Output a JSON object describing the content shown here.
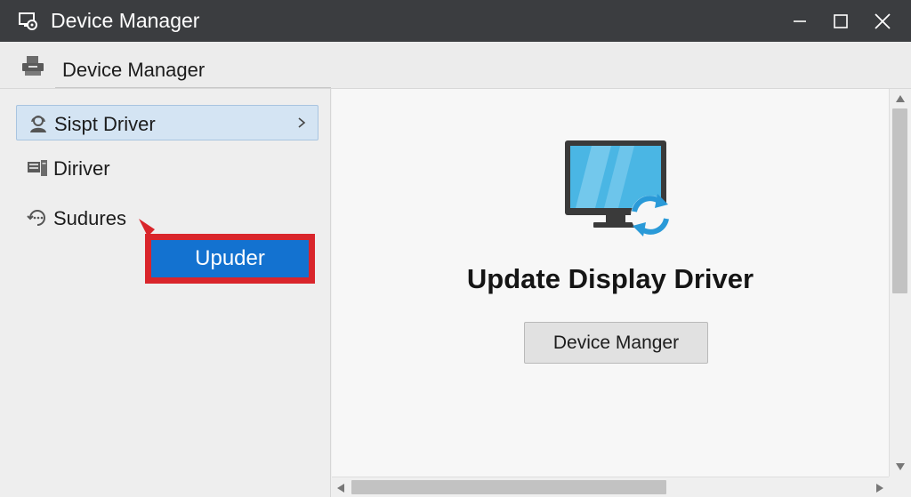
{
  "window": {
    "title": "Device Manager",
    "controls": {
      "minimize_icon": "minimize-icon",
      "maximize_icon": "maximize-icon",
      "close_icon": "close-icon"
    }
  },
  "header": {
    "title": "Device Manager",
    "icon": "device-manager-icon"
  },
  "sidebar": {
    "items": [
      {
        "label": "Sispt Driver",
        "icon": "user-support-icon",
        "selected": true,
        "chevron": "chevron-right-icon"
      },
      {
        "label": "Diriver",
        "icon": "driver-panel-icon",
        "selected": false
      },
      {
        "label": "Sudures",
        "icon": "device-refresh-icon",
        "selected": false
      }
    ],
    "callout_button": {
      "label": "Upuder",
      "highlight_color": "#d9252b",
      "button_color": "#1372d0"
    }
  },
  "main": {
    "hero_icon": "monitor-update-icon",
    "title": "Update Display Driver",
    "button_label": "Device Manger"
  },
  "scrollbars": {
    "vertical": {
      "up_icon": "scroll-up-icon",
      "down_icon": "scroll-down-icon"
    },
    "horizontal": {
      "left_icon": "scroll-left-icon",
      "right_icon": "scroll-right-icon"
    }
  },
  "colors": {
    "titlebar": "#3b3d40",
    "accent": "#1372d0",
    "selection": "#d4e4f3",
    "highlight": "#d9252b"
  }
}
